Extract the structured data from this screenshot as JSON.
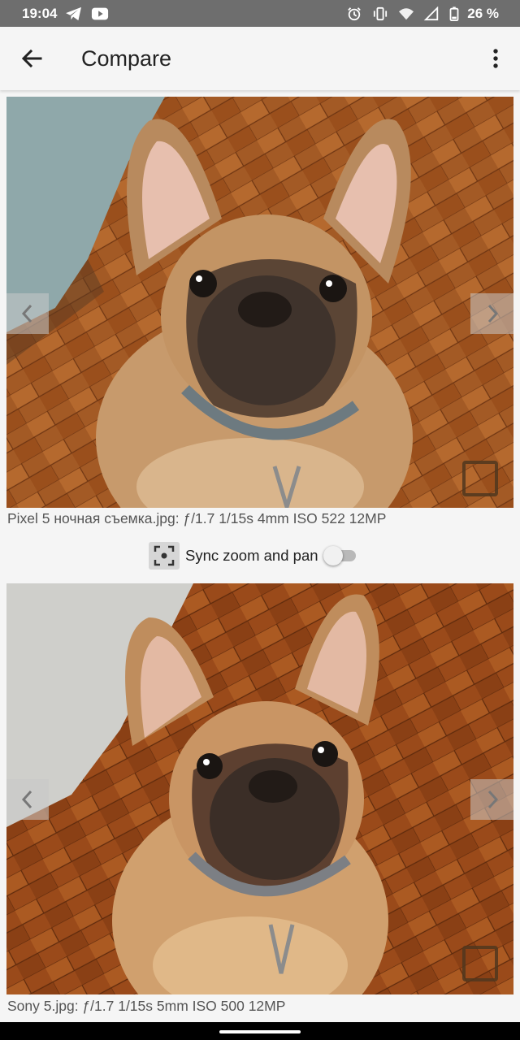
{
  "status_bar": {
    "time": "19:04",
    "battery": "26 %",
    "icons_left": [
      "telegram-icon",
      "youtube-icon"
    ],
    "icons_right": [
      "alarm-icon",
      "vibrate-icon",
      "wifi-icon",
      "signal-icon",
      "battery-icon"
    ]
  },
  "app_bar": {
    "title": "Compare",
    "back_icon": "arrow-back-icon",
    "menu_icon": "more-vert-icon"
  },
  "photos": [
    {
      "caption": "Pixel 5 ночная съемка.jpg: ƒ/1.7 1/15s 4mm ISO 522 12MP"
    },
    {
      "caption": "Sony 5.jpg: ƒ/1.7 1/15s 5mm ISO 500 12MP"
    }
  ],
  "sync": {
    "label": "Sync zoom and pan",
    "enabled": false,
    "icon": "focus-frame-icon"
  },
  "colors": {
    "status_bar": "#6e6e6e",
    "background": "#f5f5f5",
    "floor": "#a3541f",
    "dog_fur": "#c79a6c"
  }
}
